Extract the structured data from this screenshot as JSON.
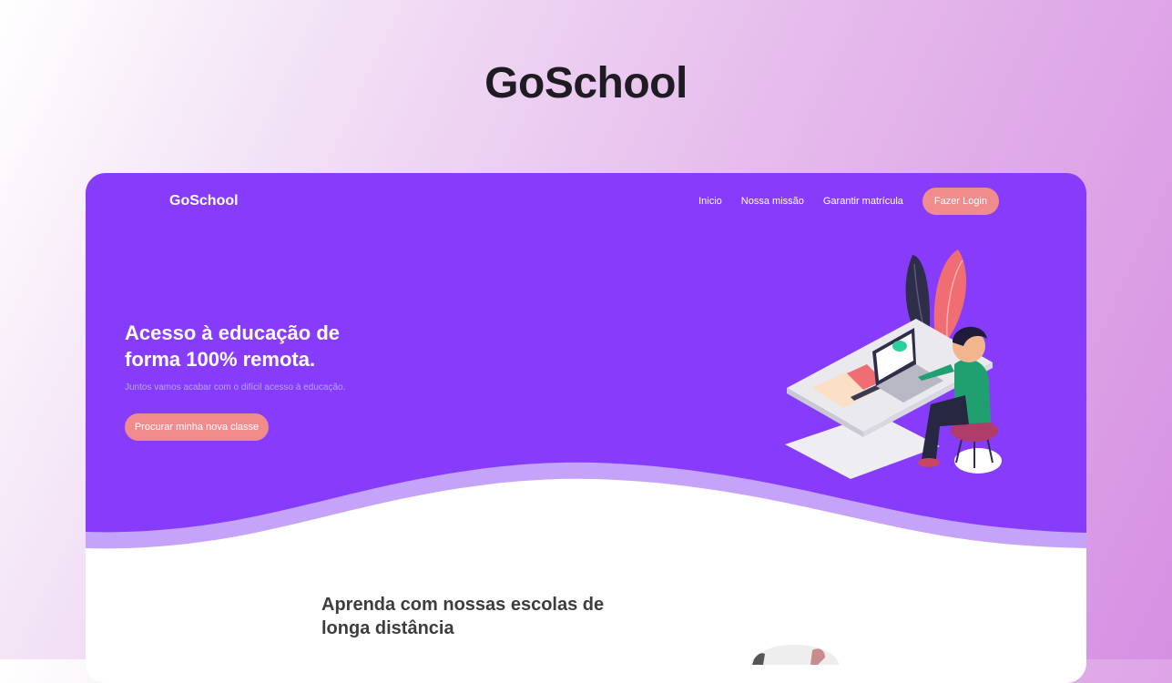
{
  "page": {
    "title": "GoSchool"
  },
  "navbar": {
    "brand": "GoSchool",
    "links": [
      "Inicio",
      "Nossa missão",
      "Garantir matrícula"
    ],
    "login_label": "Fazer Login"
  },
  "hero": {
    "title_line1": "Acesso à educação de",
    "title_line2": "forma 100% remota.",
    "subtitle": "Juntos vamos acabar com o difícil acesso à educação.",
    "cta_label": "Procurar minha nova classe"
  },
  "section": {
    "title_line1": "Aprenda com nossas escolas de",
    "title_line2": "longa distância"
  },
  "colors": {
    "primary": "#883cfb",
    "wave_light": "#c4a3f9",
    "button": "#f08c8c"
  }
}
